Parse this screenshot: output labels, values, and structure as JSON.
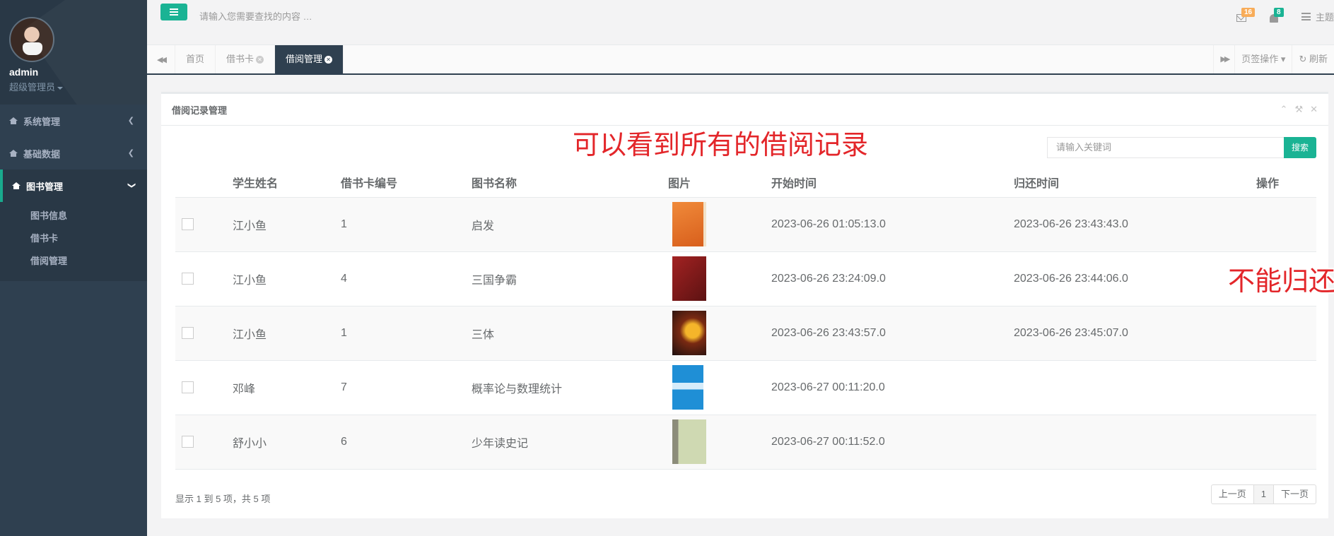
{
  "sidebar": {
    "username": "admin",
    "role": "超级管理员",
    "items": [
      {
        "label": "系统管理"
      },
      {
        "label": "基础数据"
      },
      {
        "label": "图书管理"
      }
    ],
    "subitems": [
      {
        "label": "图书信息"
      },
      {
        "label": "借书卡"
      },
      {
        "label": "借阅管理"
      }
    ]
  },
  "topbar": {
    "search_placeholder": "请输入您需要查找的内容 …",
    "mail_count": "16",
    "alert_count": "8",
    "theme_label": "主题"
  },
  "tabs": {
    "items": [
      {
        "label": "首页"
      },
      {
        "label": "借书卡"
      },
      {
        "label": "借阅管理"
      }
    ],
    "page_ops": "页签操作",
    "refresh": "刷新"
  },
  "panel": {
    "title": "借阅记录管理",
    "annotation_top": "可以看到所有的借阅记录",
    "annotation_side": "不能归还",
    "keyword_placeholder": "请输入关键词",
    "search_button": "搜索",
    "columns": [
      "学生姓名",
      "借书卡编号",
      "图书名称",
      "图片",
      "开始时间",
      "归还时间",
      "操作"
    ],
    "rows": [
      {
        "student": "江小鱼",
        "card": "1",
        "book": "启发",
        "start": "2023-06-26 01:05:13.0",
        "return": "2023-06-26 23:43:43.0",
        "cover_color": "#e8752b"
      },
      {
        "student": "江小鱼",
        "card": "4",
        "book": "三国争霸",
        "start": "2023-06-26 23:24:09.0",
        "return": "2023-06-26 23:44:06.0",
        "cover_color": "#8c1d1d"
      },
      {
        "student": "江小鱼",
        "card": "1",
        "book": "三体",
        "start": "2023-06-26 23:43:57.0",
        "return": "2023-06-26 23:45:07.0",
        "cover_color": "#5a2a1a"
      },
      {
        "student": "邓峰",
        "card": "7",
        "book": "概率论与数理统计",
        "start": "2023-06-27 00:11:20.0",
        "return": "",
        "cover_color": "#1f8fd6"
      },
      {
        "student": "舒小小",
        "card": "6",
        "book": "少年读史记",
        "start": "2023-06-27 00:11:52.0",
        "return": "",
        "cover_color": "#b9c99a"
      }
    ],
    "footer_info": "显示 1 到 5 项，共 5 项",
    "pager": {
      "prev": "上一页",
      "current": "1",
      "next": "下一页"
    }
  }
}
